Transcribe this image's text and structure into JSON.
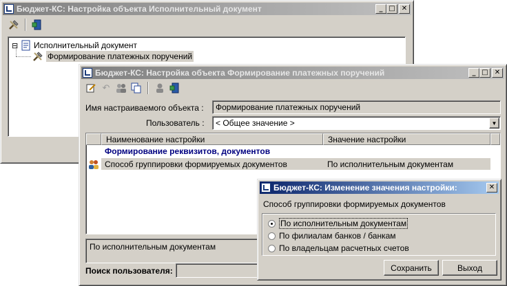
{
  "window1": {
    "title": "Бюджет-КС: Настройка объекта Исполнительный документ",
    "tree": {
      "root_label": "Исполнительный документ",
      "child_label": "Формирование платежных поручений",
      "expander": "⊟"
    }
  },
  "window2": {
    "title": "Бюджет-КС: Настройка объекта Формирование платежных поручений",
    "object_label": "Имя настраиваемого объекта :",
    "object_value": "Формирование платежных поручений",
    "user_label": "Пользователь :",
    "user_value": "< Общее значение >",
    "grid": {
      "columns": [
        "Наименование настройки",
        "Значение настройки"
      ],
      "group_label": "Формирование реквизитов, документов",
      "rows": [
        {
          "name": "Способ группировки формируемых документов",
          "value": "По исполнительным документам"
        }
      ]
    },
    "value_text": "По исполнительным документам",
    "search_label": "Поиск пользователя:"
  },
  "dialog": {
    "title": "Бюджет-КС: Изменение значения настройки:",
    "prompt": "Способ группировки формируемых документов",
    "options": [
      {
        "label": "По исполнительным документам",
        "selected": true
      },
      {
        "label": "По филиалам банков / банкам",
        "selected": false
      },
      {
        "label": "По владельцам расчетных счетов",
        "selected": false
      }
    ],
    "save_label": "Сохранить",
    "exit_label": "Выход"
  },
  "titlebar_buttons": {
    "minimize": "_",
    "maximize": "□",
    "close": "✕"
  },
  "colors": {
    "active_title": "#0a246a",
    "inactive_title": "#808080",
    "selection": "#d4d0c8",
    "group_text": "#000080"
  }
}
